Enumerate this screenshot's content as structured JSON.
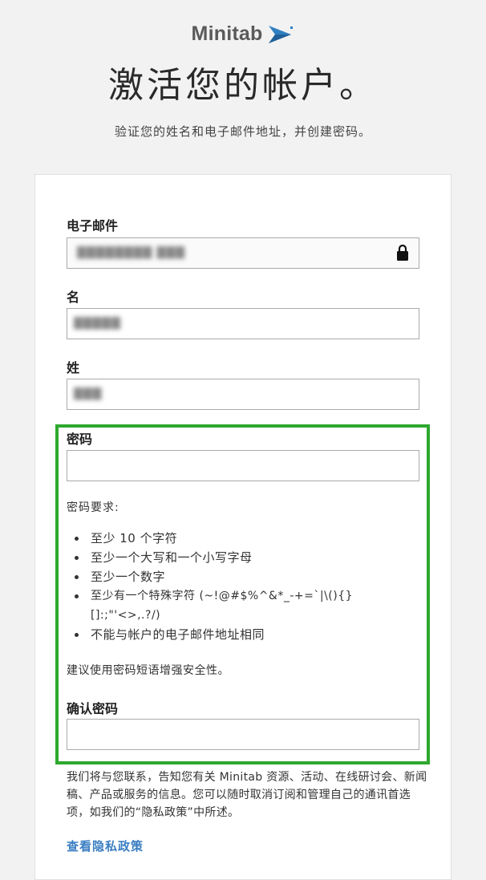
{
  "logo": {
    "text": "Minitab",
    "mark_color": "#2f7fc1"
  },
  "page": {
    "title": "激活您的帐户。",
    "subtitle": "验证您的姓名和电子邮件地址，并创建密码。"
  },
  "form": {
    "email": {
      "label": "电子邮件",
      "value": "████████ ███",
      "icon": "lock-icon"
    },
    "first_name": {
      "label": "名",
      "value": "█████"
    },
    "last_name": {
      "label": "姓",
      "value": "███"
    },
    "password": {
      "label": "密码",
      "value": ""
    },
    "requirements": {
      "heading": "密码要求:",
      "items": [
        "至少 10 个字符",
        "至少一个大写和一个小写字母",
        "至少一个数字",
        "至少有一个特殊字符 (~!@#$%^&*_-+=`|\\(){}[]:;\"'<>,.?/)",
        "不能与帐户的电子邮件地址相同"
      ]
    },
    "suggestion": "建议使用密码短语增强安全性。",
    "confirm_password": {
      "label": "确认密码",
      "value": ""
    },
    "contact_note": "我们将与您联系，告知您有关 Minitab 资源、活动、在线研讨会、新闻稿、产品或服务的信息。您可以随时取消订阅和管理自己的通讯首选项，如我们的“隐私政策”中所述。",
    "privacy_link": "查看隐私政策"
  },
  "colors": {
    "highlight": "#2ea82e",
    "link": "#3b7ec2",
    "background": "#f2f2f2"
  }
}
